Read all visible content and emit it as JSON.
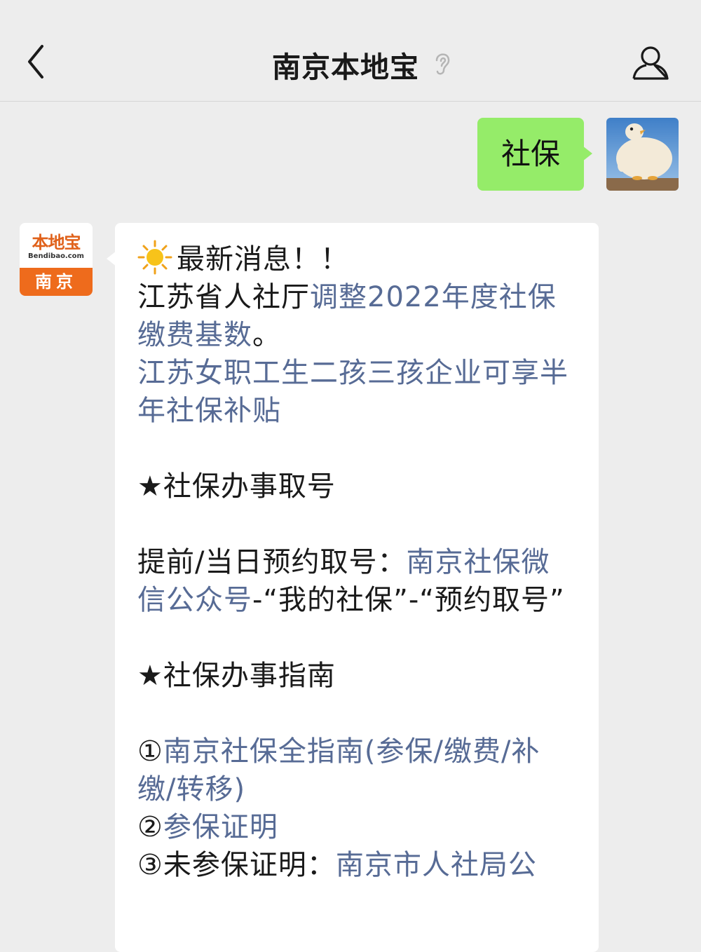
{
  "header": {
    "title": "南京本地宝",
    "back_icon": "chevron-left-icon",
    "ear_icon": "ear-icon",
    "profile_icon": "person-icon"
  },
  "outgoing": {
    "text": "社保",
    "bubble_color": "#95ec69"
  },
  "bot_avatar": {
    "logo_cn": "本地宝",
    "logo_en": "Bendibao.com",
    "city": "南京",
    "brand_color": "#ee6b1c"
  },
  "message": {
    "link_color": "#576b95",
    "news_title": "最新消息！！",
    "news_prefix": "江苏省人社厅",
    "news_link1": "调整2022年度社保缴费基数",
    "news_suffix": "。",
    "news_link2": "江苏女职工生二孩三孩企业可享半年社保补贴",
    "section1": "★社保办事取号",
    "booking_prefix": "提前/当日预约取号：",
    "booking_link": "南京社保微信公众号",
    "booking_suffix": "-“我的社保”-“预约取号”",
    "section2": "★社保办事指南",
    "item1_num": "①",
    "item1_link": "南京社保全指南(参保/缴费/补缴/转移)",
    "item2_num": "②",
    "item2_link": "参保证明",
    "item3_text": "③未参保证明：",
    "item3_link": "南京市人社局公"
  }
}
